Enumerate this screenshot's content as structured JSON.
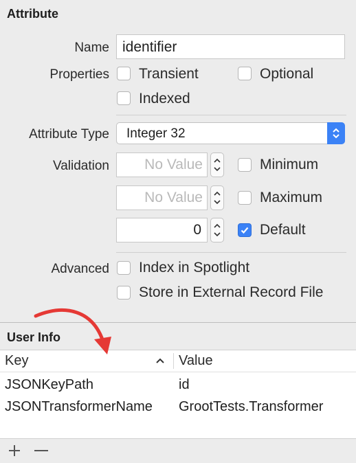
{
  "attribute": {
    "section_title": "Attribute",
    "name_label": "Name",
    "name_value": "identifier",
    "properties_label": "Properties",
    "transient_label": "Transient",
    "optional_label": "Optional",
    "indexed_label": "Indexed",
    "attribute_type_label": "Attribute Type",
    "attribute_type_value": "Integer 32",
    "validation_label": "Validation",
    "min_placeholder": "No Value",
    "max_placeholder": "No Value",
    "minimum_label": "Minimum",
    "maximum_label": "Maximum",
    "default_value": "0",
    "default_label": "Default",
    "advanced_label": "Advanced",
    "index_spotlight_label": "Index in Spotlight",
    "external_record_label": "Store in External Record File"
  },
  "user_info": {
    "section_title": "User Info",
    "columns": {
      "key": "Key",
      "value": "Value"
    },
    "rows": [
      {
        "key": "JSONKeyPath",
        "value": "id"
      },
      {
        "key": "JSONTransformerName",
        "value": "GrootTests.Transformer"
      }
    ],
    "add_symbol": "+",
    "remove_symbol": "—"
  },
  "colors": {
    "accent": "#3b82f6",
    "background": "#ececec",
    "annotation_arrow": "#e53935"
  }
}
